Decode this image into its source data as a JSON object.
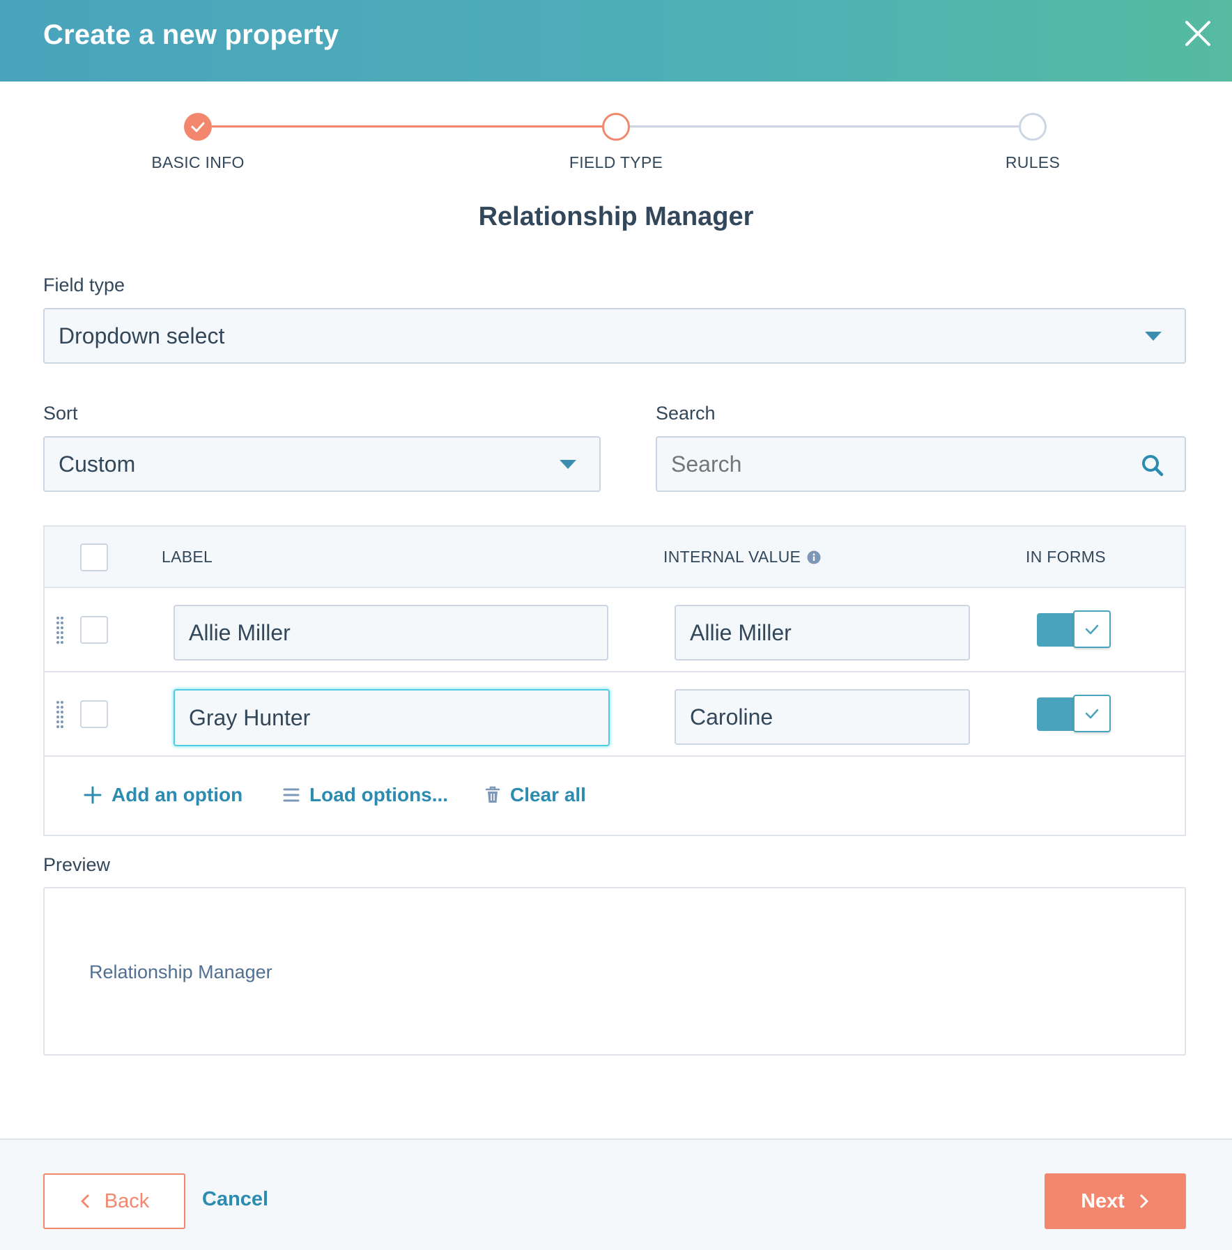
{
  "header": {
    "title": "Create a new property"
  },
  "stepper": {
    "steps": [
      {
        "label": "BASIC INFO",
        "state": "completed"
      },
      {
        "label": "FIELD TYPE",
        "state": "current"
      },
      {
        "label": "RULES",
        "state": "upcoming"
      }
    ]
  },
  "section": {
    "title": "Relationship Manager"
  },
  "field_type": {
    "label": "Field type",
    "value": "Dropdown select"
  },
  "sort": {
    "label": "Sort",
    "value": "Custom"
  },
  "search": {
    "label": "Search",
    "placeholder": "Search"
  },
  "table": {
    "columns": [
      "LABEL",
      "INTERNAL VALUE",
      "IN FORMS"
    ],
    "rows": [
      {
        "label": "Allie Miller",
        "internal_value": "Allie Miller",
        "in_forms": true
      },
      {
        "label": "Gray Hunter",
        "internal_value": "Caroline",
        "in_forms": true
      }
    ],
    "actions": {
      "add": "Add an option",
      "load": "Load options...",
      "clear": "Clear all"
    }
  },
  "preview": {
    "label": "Preview",
    "text": "Relationship Manager"
  },
  "footer": {
    "back": "Back",
    "cancel": "Cancel",
    "next": "Next"
  },
  "colors": {
    "accent": "#f2876d",
    "teal": "#4aa3bd",
    "link": "#2b8bb0",
    "text": "#33475b"
  }
}
